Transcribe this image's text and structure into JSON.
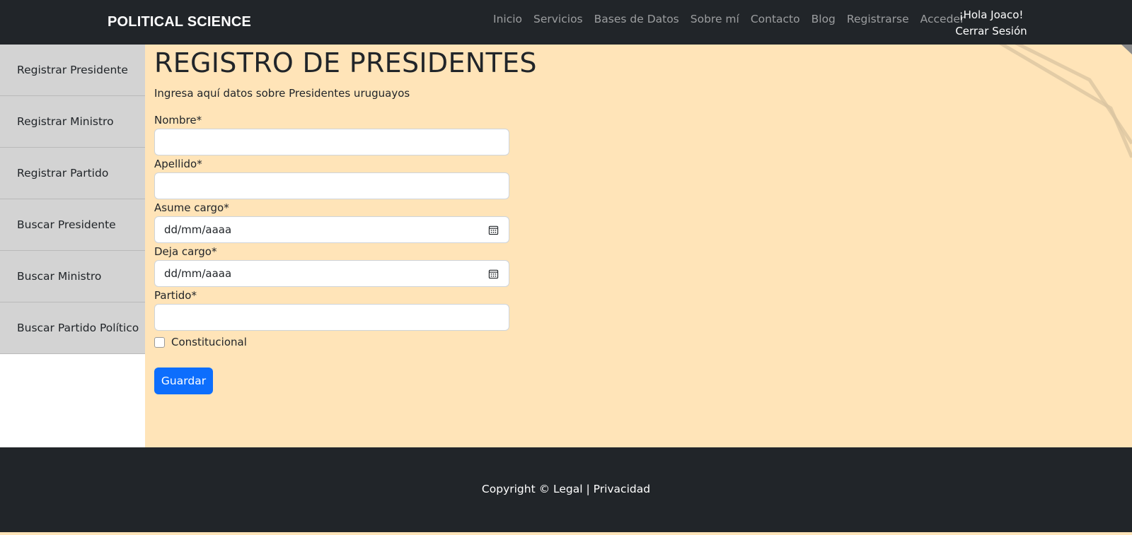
{
  "navbar": {
    "brand": "POLITICAL SCIENCE",
    "links": [
      "Inicio",
      "Servicios",
      "Bases de Datos",
      "Sobre mí",
      "Contacto",
      "Blog",
      "Registrarse",
      "Acceder"
    ],
    "greeting": "¡Hola Joaco!",
    "logout": "Cerrar Sesión"
  },
  "sidebar": {
    "items": [
      {
        "label": "Registrar Presidente"
      },
      {
        "label": "Registrar Ministro"
      },
      {
        "label": "Registrar Partido"
      },
      {
        "label": "Buscar Presidente"
      },
      {
        "label": "Buscar Ministro"
      },
      {
        "label": "Buscar Partido Político"
      }
    ]
  },
  "main": {
    "title": "REGISTRO DE PRESIDENTES",
    "subtitle": "Ingresa aquí datos sobre Presidentes uruguayos",
    "fields": {
      "nombre_label": "Nombre*",
      "nombre_value": "",
      "apellido_label": "Apellido*",
      "apellido_value": "",
      "asume_label": "Asume cargo*",
      "asume_placeholder": "dd/mm/aaaa",
      "deja_label": "Deja cargo*",
      "deja_placeholder": "dd/mm/aaaa",
      "partido_label": "Partido*",
      "partido_value": "",
      "constitucional_label": "Constitucional",
      "constitucional_checked": false
    },
    "save_label": "Guardar"
  },
  "footer": {
    "text": "Copyright © Legal | Privacidad"
  },
  "colors": {
    "navbar_bg": "#212529",
    "content_bg": "#ffe4b8",
    "sidebar_item_bg": "#d3d3d3",
    "primary_button": "#0d6efd"
  }
}
